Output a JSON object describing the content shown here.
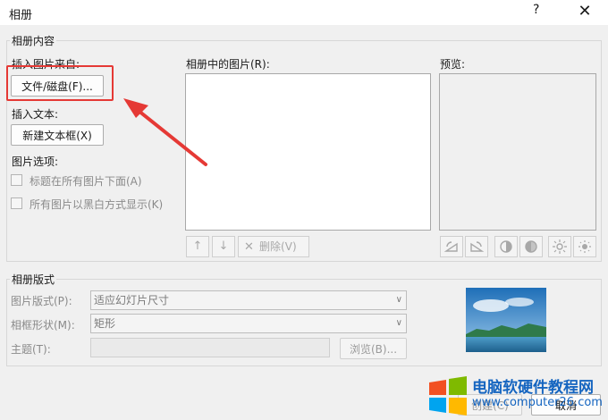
{
  "window": {
    "title": "相册",
    "help": "?",
    "close": "✕"
  },
  "album_content": {
    "group_label": "相册内容",
    "insert_from_label": "插入图片来自:",
    "file_disk_button": "文件/磁盘(F)...",
    "insert_text_label": "插入文本:",
    "new_textbox_button": "新建文本框(X)",
    "picture_options_label": "图片选项:",
    "option_captions": "标题在所有图片下面(A)",
    "option_bw": "所有图片以黑白方式显示(K)",
    "pictures_list_label": "相册中的图片(R):",
    "preview_label": "预览:",
    "move_up": "↑",
    "move_down": "↓",
    "delete_label": "删除(V)",
    "delete_icon": "✕"
  },
  "album_layout": {
    "group_label": "相册版式",
    "picture_layout_label": "图片版式(P):",
    "picture_layout_value": "适应幻灯片尺寸",
    "frame_shape_label": "相框形状(M):",
    "frame_shape_value": "矩形",
    "theme_label": "主题(T):",
    "browse_button": "浏览(B)..."
  },
  "footer": {
    "create_button": "创建(C)",
    "cancel_button": "取消"
  },
  "watermark": {
    "line1": "电脑软硬件教程网",
    "line2": "www.computer26.com"
  },
  "colors": {
    "highlight": "#e53935",
    "watermark": "#1565c0"
  },
  "icons": [
    "rotate-left-icon",
    "rotate-right-icon",
    "contrast-up-icon",
    "contrast-down-icon",
    "brightness-up-icon",
    "brightness-down-icon"
  ]
}
